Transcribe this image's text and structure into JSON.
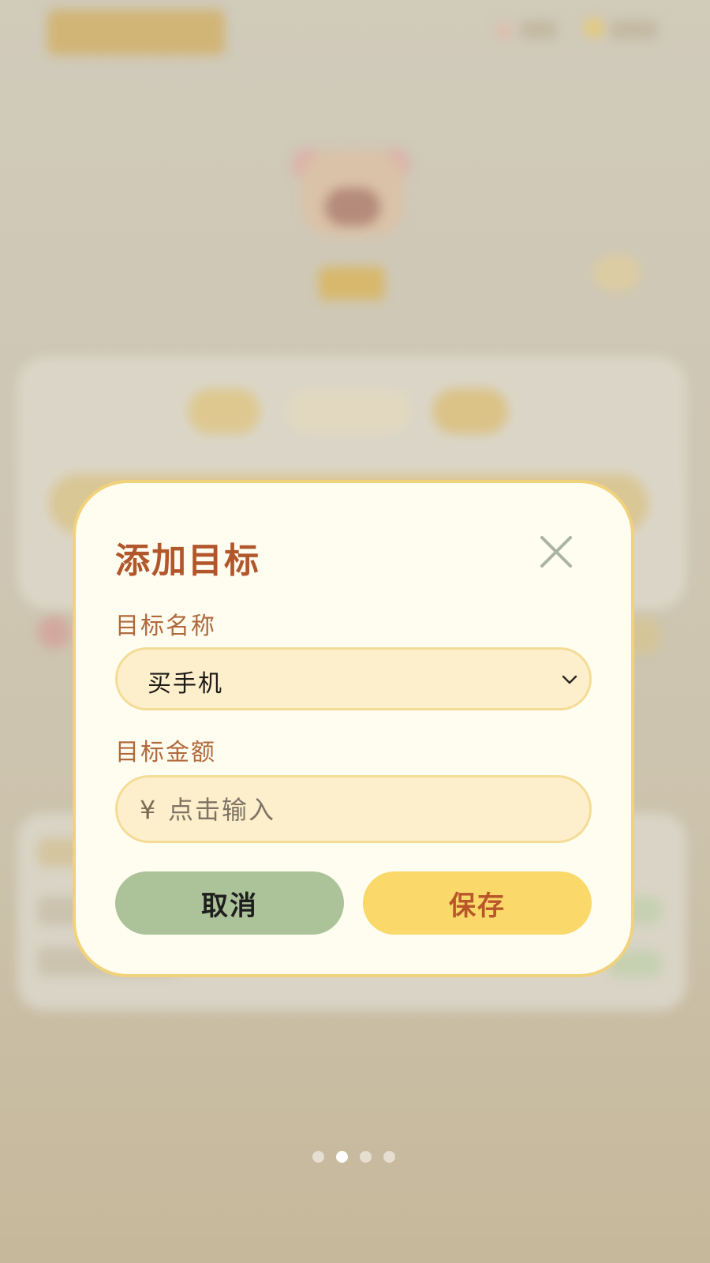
{
  "dialog": {
    "title": "添加目标",
    "close_icon": "close-icon",
    "name_field": {
      "label": "目标名称",
      "selected_value": "买手机",
      "dropdown_icon": "chevron-down-icon"
    },
    "amount_field": {
      "label": "目标金额",
      "currency_symbol": "¥",
      "placeholder": "点击输入",
      "value": ""
    },
    "cancel_label": "取消",
    "save_label": "保存"
  },
  "pager": {
    "page_count": 4,
    "active_index": 1
  },
  "colors": {
    "title": "#b2572c",
    "label": "#b0693c",
    "dialog_bg": "#fffdf0",
    "dialog_border": "#f1d27c",
    "field_bg": "#feefcc",
    "cancel_bg": "#acc39a",
    "save_bg": "#fad86a",
    "save_text": "#b8562a"
  }
}
